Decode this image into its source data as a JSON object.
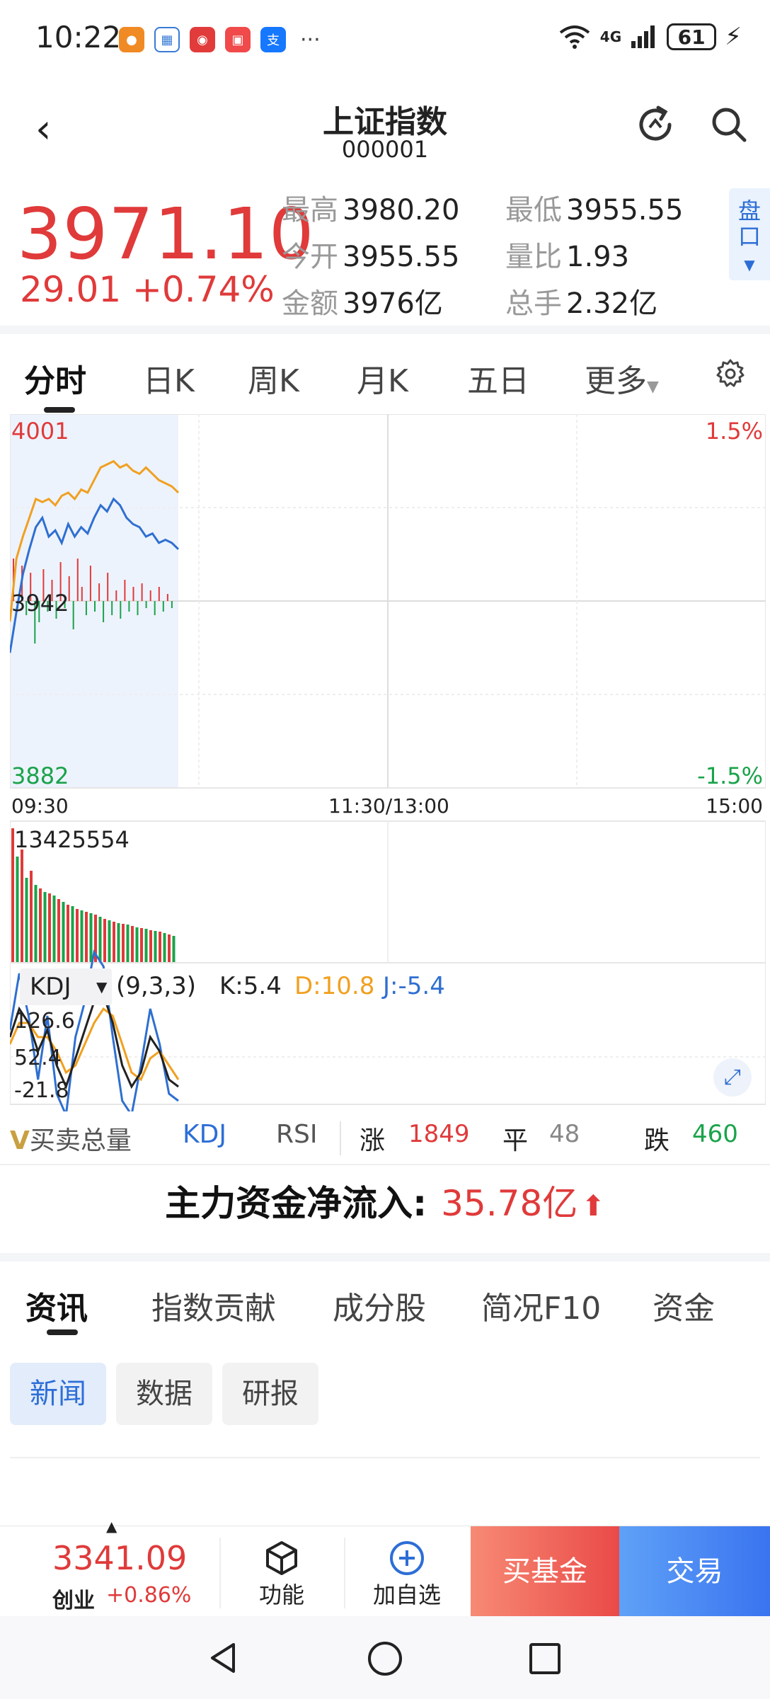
{
  "status": {
    "time": "10:22",
    "net_label": "4G",
    "battery": "61"
  },
  "header": {
    "title": "上证指数",
    "code": "000001"
  },
  "quote": {
    "price": "3971.10",
    "change": "29.01 +0.74%",
    "stats": [
      {
        "label": "最高",
        "value": "3980.20"
      },
      {
        "label": "最低",
        "value": "3955.55"
      },
      {
        "label": "今开",
        "value": "3955.55"
      },
      {
        "label": "量比",
        "value": "1.93"
      },
      {
        "label": "金额",
        "value": "3976亿"
      },
      {
        "label": "总手",
        "value": "2.32亿"
      }
    ],
    "pankou": "盘口"
  },
  "tabs": [
    "分时",
    "日K",
    "周K",
    "月K",
    "五日",
    "更多"
  ],
  "chart": {
    "price_high": "4001",
    "price_mid": "3942",
    "price_low": "3882",
    "pct_high": "1.5%",
    "pct_low": "-1.5%",
    "time_start": "09:30",
    "time_mid": "11:30/13:00",
    "time_end": "15:00",
    "volume_max": "13425554",
    "kdj_name": "KDJ",
    "kdj_params": "(9,3,3)",
    "kdj_k": "K:5.4",
    "kdj_d": "D:10.8",
    "kdj_j": "J:-5.4",
    "kdj_y1": "126.6",
    "kdj_y2": "52.4",
    "kdj_y3": "-21.8",
    "colors": {
      "up": "#e03a3a",
      "down": "#1aa34a",
      "avg": "#f0a020",
      "line": "#2f6fd1"
    }
  },
  "chart_data": {
    "type": "line",
    "x_range": [
      "09:30",
      "15:00"
    ],
    "ylim": [
      3882,
      4001
    ],
    "series": [],
    "price_estimate": [
      3925,
      3938,
      3950,
      3958,
      3965,
      3968,
      3962,
      3964,
      3960,
      3966,
      3962,
      3965,
      3963,
      3968,
      3972,
      3970,
      3974,
      3972,
      3968,
      3966,
      3965,
      3962,
      3963,
      3960,
      3961,
      3960,
      3958
    ],
    "avg_estimate": [
      3935,
      3955,
      3962,
      3968,
      3974,
      3973,
      3974,
      3972,
      3975,
      3976,
      3974,
      3977,
      3976,
      3980,
      3984,
      3985,
      3986,
      3984,
      3985,
      3983,
      3982,
      3984,
      3982,
      3980,
      3979,
      3978,
      3976
    ]
  },
  "indicators": {
    "buysell": "买卖总量",
    "kdj": "KDJ",
    "rsi": "RSI",
    "up_label": "涨",
    "up_count": "1849",
    "flat_label": "平",
    "flat_count": "48",
    "down_label": "跌",
    "down_count": "460"
  },
  "netflow": {
    "label": "主力资金净流入:",
    "value": "35.78亿"
  },
  "news_tabs": [
    "资讯",
    "指数贡献",
    "成分股",
    "简况F10",
    "资金"
  ],
  "chips": [
    "新闻",
    "数据",
    "研报"
  ],
  "bottombar": {
    "price": "3341.09",
    "name": "创业",
    "change": "+0.86%",
    "func_label": "功能",
    "add_label": "加自选",
    "fund_label": "买基金",
    "trade_label": "交易"
  }
}
